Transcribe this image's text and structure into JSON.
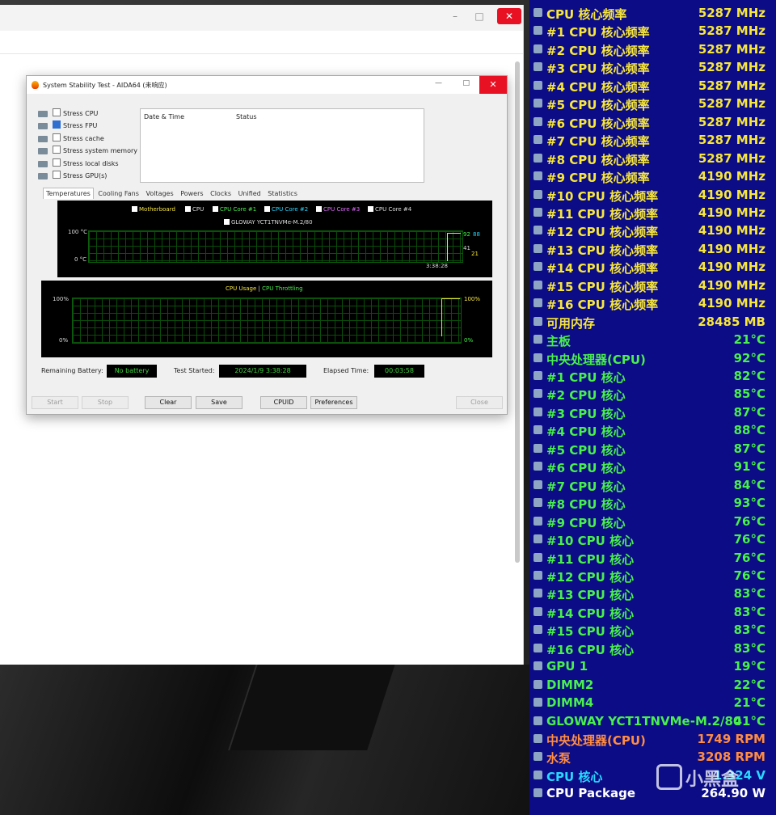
{
  "aida": {
    "title": "System Stability Test - AIDA64  (未响应)",
    "stress": [
      {
        "label": "Stress CPU",
        "checked": false
      },
      {
        "label": "Stress FPU",
        "checked": true
      },
      {
        "label": "Stress cache",
        "checked": false
      },
      {
        "label": "Stress system memory",
        "checked": false
      },
      {
        "label": "Stress local disks",
        "checked": false
      },
      {
        "label": "Stress GPU(s)",
        "checked": false
      }
    ],
    "log_headers": [
      "Date & Time",
      "Status"
    ],
    "tabs": [
      "Temperatures",
      "Cooling Fans",
      "Voltages",
      "Powers",
      "Clocks",
      "Unified",
      "Statistics"
    ],
    "temp_legend": [
      "Motherboard",
      "CPU",
      "CPU Core #1",
      "CPU Core #2",
      "CPU Core #3",
      "CPU Core #4",
      "GLOWAY YCT1TNVMe-M.2/80"
    ],
    "temp_axis": {
      "top": "100 °C",
      "bottom": "0 °C"
    },
    "temp_right": {
      "a": "92",
      "b": "88",
      "c": "41",
      "d": "21"
    },
    "temp_time": "3:38:28",
    "usage_legend": {
      "a": "CPU Usage",
      "sep": "|",
      "b": "CPU Throttling"
    },
    "usage_axis": {
      "top": "100%",
      "bottom": "0%",
      "rtop": "100%",
      "rbottom": "0%"
    },
    "remaining_label": "Remaining Battery:",
    "remaining_value": "No battery",
    "started_label": "Test Started:",
    "started_value": "2024/1/9 3:38:28",
    "elapsed_label": "Elapsed Time:",
    "elapsed_value": "00:03:58",
    "buttons": {
      "start": "Start",
      "stop": "Stop",
      "clear": "Clear",
      "save": "Save",
      "cpuid": "CPUID",
      "preferences": "Preferences",
      "close": "Close"
    }
  },
  "osd": [
    {
      "label": "CPU 核心频率",
      "value": "5287 MHz",
      "color": "#f7e63c"
    },
    {
      "label": "#1 CPU 核心频率",
      "value": "5287 MHz",
      "color": "#f7e63c"
    },
    {
      "label": "#2 CPU 核心频率",
      "value": "5287 MHz",
      "color": "#f7e63c"
    },
    {
      "label": "#3 CPU 核心频率",
      "value": "5287 MHz",
      "color": "#f7e63c"
    },
    {
      "label": "#4 CPU 核心频率",
      "value": "5287 MHz",
      "color": "#f7e63c"
    },
    {
      "label": "#5 CPU 核心频率",
      "value": "5287 MHz",
      "color": "#f7e63c"
    },
    {
      "label": "#6 CPU 核心频率",
      "value": "5287 MHz",
      "color": "#f7e63c"
    },
    {
      "label": "#7 CPU 核心频率",
      "value": "5287 MHz",
      "color": "#f7e63c"
    },
    {
      "label": "#8 CPU 核心频率",
      "value": "5287 MHz",
      "color": "#f7e63c"
    },
    {
      "label": "#9 CPU 核心频率",
      "value": "4190 MHz",
      "color": "#f7e63c"
    },
    {
      "label": "#10 CPU 核心频率",
      "value": "4190 MHz",
      "color": "#f7e63c"
    },
    {
      "label": "#11 CPU 核心频率",
      "value": "4190 MHz",
      "color": "#f7e63c"
    },
    {
      "label": "#12 CPU 核心频率",
      "value": "4190 MHz",
      "color": "#f7e63c"
    },
    {
      "label": "#13 CPU 核心频率",
      "value": "4190 MHz",
      "color": "#f7e63c"
    },
    {
      "label": "#14 CPU 核心频率",
      "value": "4190 MHz",
      "color": "#f7e63c"
    },
    {
      "label": "#15 CPU 核心频率",
      "value": "4190 MHz",
      "color": "#f7e63c"
    },
    {
      "label": "#16 CPU 核心频率",
      "value": "4190 MHz",
      "color": "#f7e63c"
    },
    {
      "label": "可用内存",
      "value": "28485 MB",
      "color": "#f7e63c"
    },
    {
      "label": "主板",
      "value": "21°C",
      "color": "#49f04d"
    },
    {
      "label": "中央处理器(CPU)",
      "value": "92°C",
      "color": "#49f04d"
    },
    {
      "label": " #1 CPU 核心",
      "value": "82°C",
      "color": "#49f04d"
    },
    {
      "label": " #2 CPU 核心",
      "value": "85°C",
      "color": "#49f04d"
    },
    {
      "label": " #3 CPU 核心",
      "value": "87°C",
      "color": "#49f04d"
    },
    {
      "label": " #4 CPU 核心",
      "value": "88°C",
      "color": "#49f04d"
    },
    {
      "label": " #5 CPU 核心",
      "value": "87°C",
      "color": "#49f04d"
    },
    {
      "label": " #6 CPU 核心",
      "value": "91°C",
      "color": "#49f04d"
    },
    {
      "label": " #7 CPU 核心",
      "value": "84°C",
      "color": "#49f04d"
    },
    {
      "label": " #8 CPU 核心",
      "value": "93°C",
      "color": "#49f04d"
    },
    {
      "label": " #9 CPU 核心",
      "value": "76°C",
      "color": "#49f04d"
    },
    {
      "label": " #10 CPU 核心",
      "value": "76°C",
      "color": "#49f04d"
    },
    {
      "label": " #11 CPU 核心",
      "value": "76°C",
      "color": "#49f04d"
    },
    {
      "label": " #12 CPU 核心",
      "value": "76°C",
      "color": "#49f04d"
    },
    {
      "label": " #13 CPU 核心",
      "value": "83°C",
      "color": "#49f04d"
    },
    {
      "label": " #14 CPU 核心",
      "value": "83°C",
      "color": "#49f04d"
    },
    {
      "label": " #15 CPU 核心",
      "value": "83°C",
      "color": "#49f04d"
    },
    {
      "label": " #16 CPU 核心",
      "value": "83°C",
      "color": "#49f04d"
    },
    {
      "label": "GPU 1",
      "value": "19°C",
      "color": "#49f04d"
    },
    {
      "label": "DIMM2",
      "value": "22°C",
      "color": "#49f04d"
    },
    {
      "label": "DIMM4",
      "value": "21°C",
      "color": "#49f04d"
    },
    {
      "label": "GLOWAY YCT1TNVMe-M.2/80",
      "value": "41°C",
      "color": "#49f04d"
    },
    {
      "label": "中央处理器(CPU)",
      "value": "1749 RPM",
      "color": "#ff8c42"
    },
    {
      "label": "水泵",
      "value": "3208 RPM",
      "color": "#ff8c42"
    },
    {
      "label": "CPU 核心",
      "value": "1.324 V",
      "color": "#29d8ff"
    },
    {
      "label": "CPU Package",
      "value": "264.90 W",
      "color": "#ffffff"
    }
  ],
  "watermark": "小黑盒"
}
